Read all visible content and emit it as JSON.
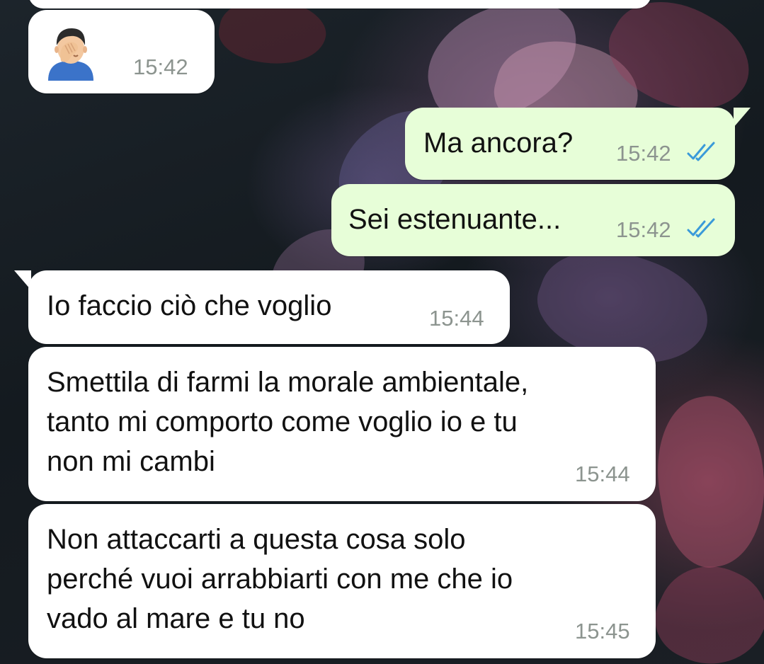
{
  "chat": {
    "messages": [
      {
        "direction": "incoming",
        "emoji": "facepalm-man-emoji",
        "time": "15:42"
      },
      {
        "direction": "outgoing",
        "text": "Ma ancora?",
        "time": "15:42",
        "status": "read"
      },
      {
        "direction": "outgoing",
        "text": "Sei estenuante...",
        "time": "15:42",
        "status": "read"
      },
      {
        "direction": "incoming",
        "text": "Io faccio ciò che voglio",
        "time": "15:44"
      },
      {
        "direction": "incoming",
        "text": "Smettila di farmi la morale ambientale,\ntanto mi comporto come voglio io e tu\nnon mi cambi",
        "time": "15:44"
      },
      {
        "direction": "incoming",
        "text": "Non attaccarti a questa cosa solo\nperché vuoi arrabbiarti con me che io\nvado al mare e tu no",
        "time": "15:45"
      }
    ]
  },
  "colors": {
    "incoming_bubble": "#ffffff",
    "outgoing_bubble": "#e7fed8",
    "read_ticks": "#3a9ad9",
    "timestamp": "#8c948f"
  }
}
